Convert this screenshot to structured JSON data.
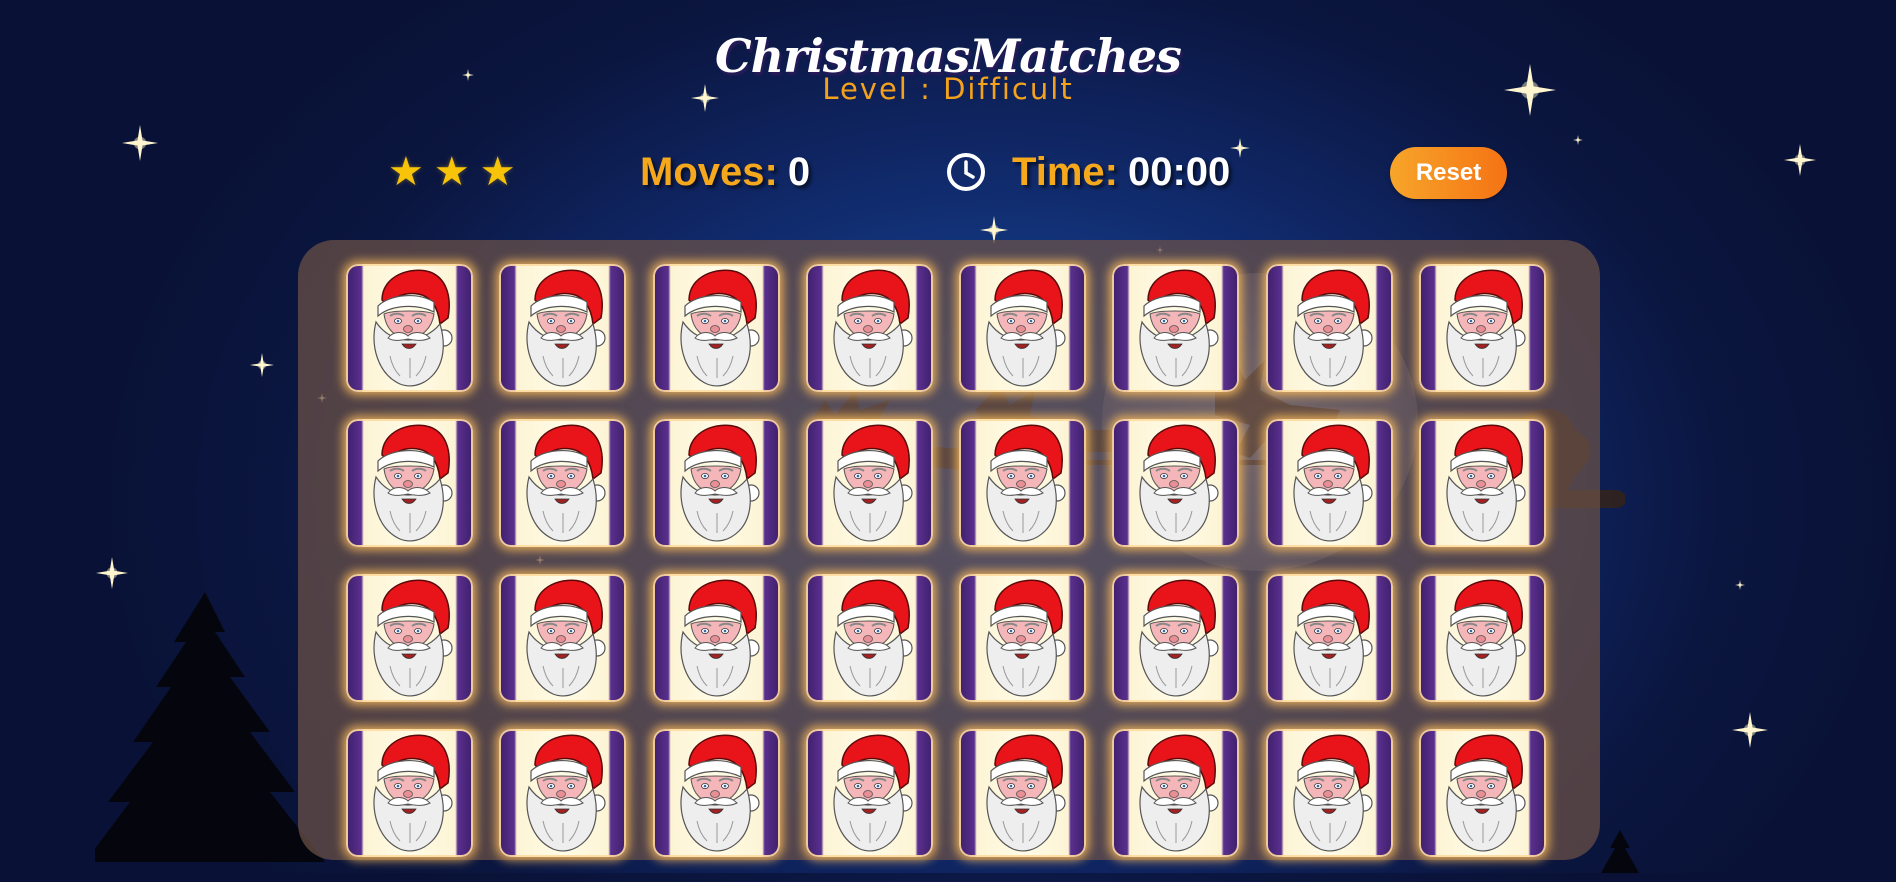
{
  "game": {
    "title": "ChristmasMatches",
    "level": "Level : Difficult"
  },
  "hud": {
    "star_rating": 3,
    "star_icons": [
      "star-icon",
      "star-icon",
      "star-icon"
    ],
    "moves_label": "Moves:",
    "moves_value": "0",
    "time_label": "Time:",
    "time_value": "00:00",
    "reset_label": "Reset"
  },
  "board": {
    "rows": 4,
    "columns": 8,
    "card_back": "santa-face-icon",
    "card_count": 32
  },
  "colors": {
    "accent": "#f5a81c",
    "reset_button": "#f57314",
    "background": "#0f2460"
  }
}
